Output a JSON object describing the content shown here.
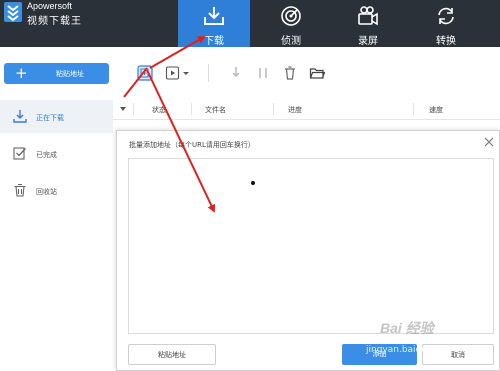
{
  "brand": "Apowersoft",
  "app_title": "视频下载王",
  "nav_tabs": [
    {
      "label": "下载",
      "icon": "download-tray-icon",
      "active": true
    },
    {
      "label": "侦测",
      "icon": "radar-icon",
      "active": false
    },
    {
      "label": "录屏",
      "icon": "video-camera-icon",
      "active": false
    },
    {
      "label": "转换",
      "icon": "convert-icon",
      "active": false
    }
  ],
  "toolbar": {
    "paste_label": "粘贴地址",
    "paste_symbol": "+",
    "icons": [
      "batch-add-icon",
      "media-dropdown-icon",
      "download-icon",
      "pause-icon",
      "delete-icon",
      "folder-icon"
    ]
  },
  "sidebar": {
    "items": [
      {
        "label": "正在下载",
        "icon": "download-icon",
        "active": true
      },
      {
        "label": "已完成",
        "icon": "completed-icon",
        "active": false
      },
      {
        "label": "回收站",
        "icon": "trash-icon",
        "active": false
      }
    ]
  },
  "table": {
    "columns": [
      "状态",
      "文件名",
      "进度",
      "速度"
    ]
  },
  "dialog": {
    "title": "批量添加地址（每个URL请用回车换行）",
    "paste_label": "粘贴地址",
    "add_label": "添加",
    "cancel_label": "取消"
  },
  "watermark": "Bai 经验",
  "watermark_url": "jingyan.baidu.com",
  "colors": {
    "topbar": "#2b3139",
    "accent": "#2f7fd8",
    "button_blue": "#3a8ee6",
    "annotation_red": "#e02020"
  }
}
